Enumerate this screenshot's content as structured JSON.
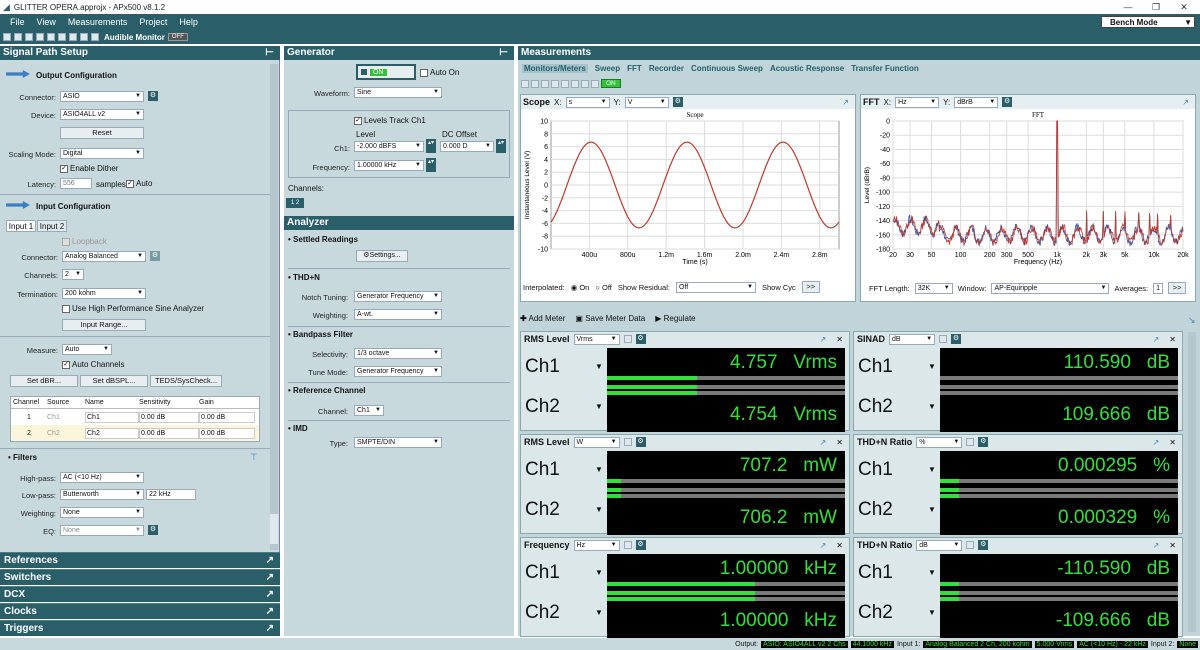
{
  "window": {
    "title": "GLITTER OPERA.approjx - APx500 v8.1.2"
  },
  "menu": [
    "File",
    "View",
    "Measurements",
    "Project",
    "Help"
  ],
  "toolbar": {
    "audible_monitor": "Audible Monitor",
    "audible_state": "OFF"
  },
  "bench_mode": "Bench Mode",
  "signal_path": {
    "title": "Signal Path Setup",
    "output_config": "Output Configuration",
    "connector_label": "Connector:",
    "connector": "ASIO",
    "device_label": "Device:",
    "device": "ASIO4ALL v2",
    "reset": "Reset",
    "scaling_label": "Scaling Mode:",
    "scaling": "Digital",
    "enable_dither": "Enable Dither",
    "latency_label": "Latency:",
    "latency": "556",
    "latency_unit": "samples",
    "latency_auto": "Auto",
    "input_config": "Input Configuration",
    "input_tabs": [
      "Input 1",
      "Input 2"
    ],
    "loopback": "Loopback",
    "in_connector_label": "Connector:",
    "in_connector": "Analog Balanced",
    "channels_label": "Channels:",
    "channels": "2",
    "termination_label": "Termination:",
    "termination": "200 kohm",
    "hp_sine": "Use High Performance Sine Analyzer",
    "input_range": "Input Range...",
    "measure_label": "Measure:",
    "measure": "Auto",
    "auto_channels": "Auto Channels",
    "set_dbr": "Set dBR...",
    "set_dbspl": "Set dBSPL...",
    "teds": "TEDS/SysCheck...",
    "table_headers": [
      "Channel",
      "Source",
      "Name",
      "Sensitivity",
      "Gain"
    ],
    "table_rows": [
      {
        "channel": "1",
        "source": "Ch1",
        "name": "Ch1",
        "sensitivity": "0.00 dB",
        "gain": "0.00 dB"
      },
      {
        "channel": "2",
        "source": "Ch2",
        "name": "Ch2",
        "sensitivity": "0.00 dB",
        "gain": "0.00 dB"
      }
    ],
    "filters": "Filters",
    "highpass_label": "High-pass:",
    "highpass": "AC (<10 Hz)",
    "lowpass_label": "Low-pass:",
    "lowpass": "Butterworth",
    "lowpass_freq": "22 kHz",
    "weighting_label": "Weighting:",
    "weighting": "None",
    "eq_label": "EQ:",
    "eq": "None"
  },
  "bottom_sections": [
    "References",
    "Switchers",
    "DCX",
    "Clocks",
    "Triggers"
  ],
  "generator": {
    "title": "Generator",
    "on": "ON",
    "auto_on": "Auto On",
    "waveform_label": "Waveform:",
    "waveform": "Sine",
    "levels_track": "Levels Track Ch1",
    "level_hdr": "Level",
    "dc_hdr": "DC Offset",
    "ch1_label": "Ch1:",
    "ch1_level": "-2.000 dBFS",
    "dc_offset": "0.000 D",
    "freq_label": "Frequency:",
    "frequency": "1.00000 kHz",
    "channels_label": "Channels:"
  },
  "analyzer": {
    "title": "Analyzer",
    "settled": "Settled Readings",
    "settings": "Settings...",
    "thdn": "THD+N",
    "notch_label": "Notch Tuning:",
    "notch": "Generator Frequency",
    "weighting_label": "Weighting:",
    "weighting": "A-wt.",
    "bandpass": "Bandpass Filter",
    "selectivity_label": "Selectivity:",
    "selectivity": "1/3 octave",
    "tune_label": "Tune Mode:",
    "tune": "Generator Frequency",
    "refch": "Reference Channel",
    "channel_label": "Channel:",
    "channel": "Ch1",
    "imd": "IMD",
    "type_label": "Type:",
    "type": "SMPTE/DIN"
  },
  "measurements": {
    "title": "Measurements",
    "tabs": [
      "Monitors/Meters",
      "Sweep",
      "FFT",
      "Recorder",
      "Continuous Sweep",
      "Acoustic Response",
      "Transfer Function"
    ],
    "on": "ON",
    "scope": {
      "title": "Scope",
      "x_label": "X:",
      "x": "s",
      "y_label": "Y:",
      "y": "V",
      "chart_title": "Scope",
      "interpolated": "Interpolated:",
      "on": "On",
      "off": "Off",
      "show_residual": "Show Residual:",
      "residual": "Off",
      "show_cyc": "Show Cyc"
    },
    "fft": {
      "title": "FFT",
      "x_label": "X:",
      "x": "Hz",
      "y_label": "Y:",
      "y": "dBrB",
      "chart_title": "FFT",
      "length_label": "FFT Length:",
      "length": "32K",
      "window_label": "Window:",
      "window": "AP-Equiripple",
      "averages_label": "Averages:",
      "averages": "1"
    },
    "add_meter": "Add Meter",
    "save_meter": "Save Meter Data",
    "regulate": "Regulate",
    "meters": [
      {
        "title": "RMS Level",
        "unit": "Vrms",
        "ch1": "4.757",
        "ch2": "4.754",
        "u": "Vrms",
        "fill1": 0.38,
        "fill2": 0.38
      },
      {
        "title": "SINAD",
        "unit": "dB",
        "ch1": "110.590",
        "ch2": "109.666",
        "u": "dB",
        "fill1": 0.0,
        "fill2": 0.0
      },
      {
        "title": "RMS Level",
        "unit": "W",
        "ch1": "707.2",
        "ch2": "706.2",
        "u": "mW",
        "fill1": 0.06,
        "fill2": 0.06
      },
      {
        "title": "THD+N Ratio",
        "unit": "%",
        "ch1": "0.000295",
        "ch2": "0.000329",
        "u": "%",
        "fill1": 0.08,
        "fill2": 0.08
      },
      {
        "title": "Frequency",
        "unit": "Hz",
        "ch1": "1.00000",
        "ch2": "1.00000",
        "u": "kHz",
        "fill1": 0.62,
        "fill2": 0.62
      },
      {
        "title": "THD+N Ratio",
        "unit": "dB",
        "ch1": "-110.590",
        "ch2": "-109.666",
        "u": "dB",
        "fill1": 0.08,
        "fill2": 0.08
      }
    ],
    "ch_labels": [
      "Ch1",
      "Ch2"
    ]
  },
  "status": {
    "output_label": "Output:",
    "output": "ASIO: ASIO4ALL v2 2 Chs",
    "output_rate": "44.1000 kHz",
    "input1_label": "Input 1:",
    "input1": "Analog Balanced 2 Ch, 200 kohm",
    "input1_range": "5.000 Vrms",
    "input1_filter": "AC (<10 Hz) - 22 kHz",
    "input2_label": "Input 2:",
    "input2": "None"
  },
  "chart_data": [
    {
      "type": "line",
      "title": "Scope",
      "xlabel": "Time (s)",
      "ylabel": "Instantaneous Level (V)",
      "x_ticks": [
        "400u",
        "800u",
        "1.2m",
        "1.6m",
        "2.0m",
        "2.4m",
        "2.8m"
      ],
      "y_ticks": [
        "10",
        "8",
        "6",
        "4",
        "2",
        "0",
        "-2",
        "-4",
        "-6",
        "-8",
        "-10"
      ],
      "xlim": [
        0,
        0.003
      ],
      "ylim": [
        -10,
        10
      ],
      "series": [
        {
          "amplitude": 6.7,
          "frequency_hz": 1000
        }
      ]
    },
    {
      "type": "line",
      "title": "FFT",
      "xlabel": "Frequency (Hz)",
      "ylabel": "Level (dBrB)",
      "x_ticks": [
        "20",
        "30",
        "50",
        "100",
        "200",
        "300",
        "500",
        "1k",
        "2k",
        "3k",
        "5k",
        "10k",
        "20k"
      ],
      "y_ticks": [
        "0",
        "-20",
        "-40",
        "-60",
        "-80",
        "-100",
        "-120",
        "-140",
        "-160",
        "-180"
      ],
      "xlim": [
        20,
        20000
      ],
      "ylim": [
        -180,
        0
      ],
      "x_scale": "log",
      "series": [
        {
          "peak_freq": 1000,
          "peak_level": 0,
          "noise_floor": -160
        }
      ]
    }
  ],
  "colors": {
    "panel": "#c8d9de",
    "header": "#2a5f6a",
    "meter_green": "#33e03a",
    "tab_text": "#22606b"
  }
}
